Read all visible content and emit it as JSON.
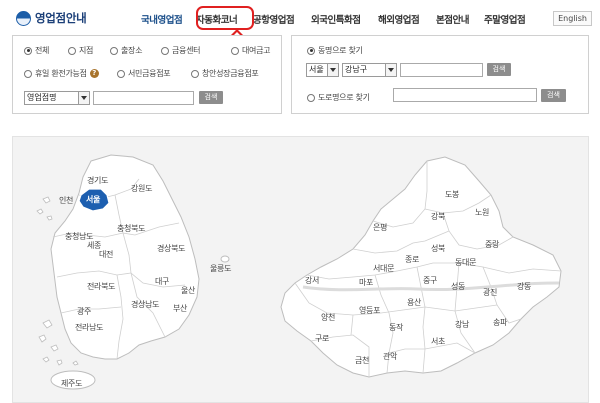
{
  "header": {
    "logo_text": "영업점안내",
    "nav": [
      "국내영업점",
      "자동화코너",
      "공항영업점",
      "외국인특화점",
      "해외영업점",
      "본점안내",
      "주말영업점"
    ],
    "lang_button": "English"
  },
  "left_panel": {
    "radios": [
      {
        "label": "전체",
        "checked": true
      },
      {
        "label": "지점",
        "checked": false
      },
      {
        "label": "출장소",
        "checked": false
      },
      {
        "label": "금융센터",
        "checked": false
      },
      {
        "label": "대여금고",
        "checked": false
      },
      {
        "label": "휴일 환전가능점",
        "checked": false
      },
      {
        "label": "서민금융점포",
        "checked": false
      },
      {
        "label": "창안성장금융점포",
        "checked": false
      }
    ],
    "search_select": "영업점명",
    "search_button": "검색"
  },
  "right_panel": {
    "option_dong": "동명으로 찾기",
    "city_select": "서울",
    "district_select": "강남구",
    "search_button_1": "검색",
    "option_road": "도로명으로 찾기",
    "search_button_2": "검색"
  },
  "korea_map": {
    "regions": [
      "경기도",
      "강원도",
      "인천",
      "서울",
      "충청남도",
      "충청북도",
      "세종",
      "대전",
      "경상북도",
      "전라북도",
      "대구",
      "울릉도",
      "울산",
      "부산",
      "경상남도",
      "광주",
      "전라남도",
      "제주도"
    ],
    "selected": "서울"
  },
  "seoul_map": {
    "districts": [
      "도봉",
      "강북",
      "노원",
      "은평",
      "성북",
      "중랑",
      "종로",
      "동대문",
      "서대문",
      "중구",
      "강서",
      "마포",
      "성동",
      "광진",
      "강동",
      "용산",
      "영등포",
      "양천",
      "동작",
      "서초",
      "강남",
      "송파",
      "구로",
      "금천",
      "관악"
    ]
  },
  "colors": {
    "accent": "#1b4f8a",
    "selected_region": "#1d5fb0",
    "highlight": "#e02020"
  }
}
